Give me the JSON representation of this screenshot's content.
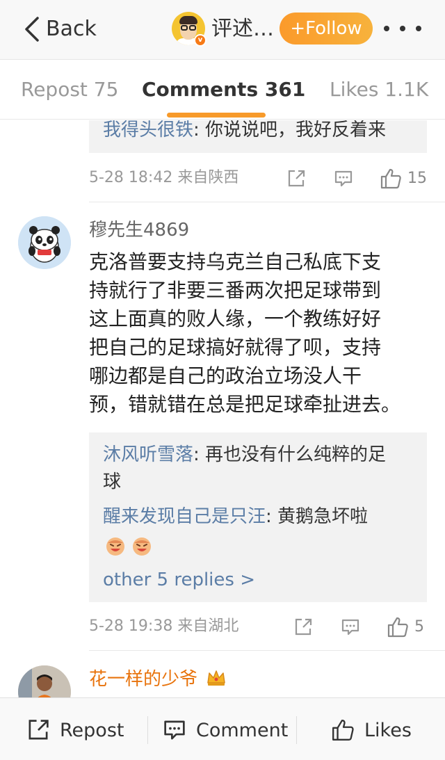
{
  "topbar": {
    "back_label": "Back",
    "account_name": "评述…",
    "verified_badge": "v",
    "follow_label": "+Follow"
  },
  "tabs": [
    {
      "label": "Repost 75",
      "active": false
    },
    {
      "label": "Comments 361",
      "active": true
    },
    {
      "label": "Likes 1.1K",
      "active": false
    }
  ],
  "accent_color": "#f79a2a",
  "link_color": "#5b7da6",
  "comments": [
    {
      "replies": [
        {
          "user": "我得头很铁",
          "text": ": 你说说吧，我好反着来"
        }
      ],
      "time": "5-28 18:42",
      "location": "来自陕西",
      "likes": "15"
    },
    {
      "user": "穆先生4869",
      "body_lines": [
        "克洛普要支持乌克兰自己私底下支",
        "持就行了非要三番两次把足球带到",
        "这上面真的败人缘，一个教练好好",
        "把自己的足球搞好就得了呗，支持",
        "哪边都是自己的政治立场没人干",
        "预，错就错在总是把足球牵扯进去。"
      ],
      "replies": [
        {
          "user": "沐风听雪落",
          "text": ": 再也没有什么纯粹的足",
          "text_cont": "球"
        },
        {
          "user": "醒来发现自己是只汪",
          "text": ": 黄鹅急坏啦"
        }
      ],
      "more_replies": "other 5 replies >",
      "time": "5-28 19:38",
      "location": "来自湖北",
      "likes": "5"
    },
    {
      "user": "花一样的少爷",
      "user_color": "#e8730c",
      "crown_icon": "crown-icon"
    }
  ],
  "bottombar": {
    "repost_label": "Repost",
    "comment_label": "Comment",
    "likes_label": "Likes"
  }
}
